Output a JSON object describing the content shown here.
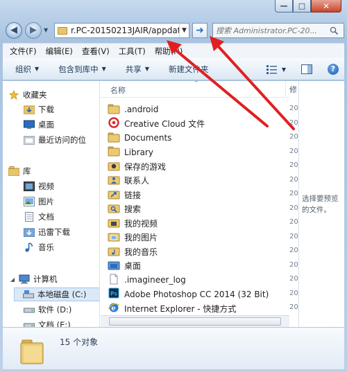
{
  "window": {
    "minimize_glyph": "—",
    "maximize_glyph": "□",
    "close_glyph": "✕"
  },
  "address": {
    "path": "r.PC-20150213JAIR/appdata",
    "go_glyph": "➜"
  },
  "search": {
    "placeholder": "搜索 Administrator.PC-20..."
  },
  "menu": [
    "文件(F)",
    "编辑(E)",
    "查看(V)",
    "工具(T)",
    "帮助(H)"
  ],
  "toolbar": {
    "organize": "组织",
    "include_in_library": "包含到库中",
    "share": "共享",
    "new_folder": "新建文件夹",
    "help_glyph": "?"
  },
  "nav_pane": {
    "favorites_header": "收藏夹",
    "favorites": [
      "下载",
      "桌面",
      "最近访问的位"
    ],
    "libraries_header": "库",
    "libraries": [
      "视频",
      "图片",
      "文档",
      "迅雷下载",
      "音乐"
    ],
    "computer_header": "计算机",
    "drives": [
      "本地磁盘 (C:)",
      "软件 (D:)",
      "文档 (E:)"
    ]
  },
  "file_list": {
    "column_name": "名称",
    "column_modified": "修",
    "files": [
      {
        "name": ".android",
        "icon": "folder-icon",
        "date_frag": "20"
      },
      {
        "name": "Creative Cloud 文件",
        "icon": "creative-cloud-icon",
        "date_frag": "20"
      },
      {
        "name": "Documents",
        "icon": "folder-icon",
        "date_frag": "20"
      },
      {
        "name": "Library",
        "icon": "folder-icon",
        "date_frag": "20"
      },
      {
        "name": "保存的游戏",
        "icon": "saved-games-icon",
        "date_frag": "20"
      },
      {
        "name": "联系人",
        "icon": "contacts-icon",
        "date_frag": "20"
      },
      {
        "name": "链接",
        "icon": "links-icon",
        "date_frag": "20"
      },
      {
        "name": "搜索",
        "icon": "searches-icon",
        "date_frag": "20"
      },
      {
        "name": "我的视频",
        "icon": "my-videos-icon",
        "date_frag": "20"
      },
      {
        "name": "我的图片",
        "icon": "my-pictures-icon",
        "date_frag": "20"
      },
      {
        "name": "我的音乐",
        "icon": "my-music-icon",
        "date_frag": "20"
      },
      {
        "name": "桌面",
        "icon": "desktop-folder-icon",
        "date_frag": "20"
      },
      {
        "name": ".imagineer_log",
        "icon": "file-icon",
        "date_frag": "20"
      },
      {
        "name": "Adobe Photoshop CC 2014 (32 Bit)",
        "icon": "photoshop-icon",
        "date_frag": "20"
      },
      {
        "name": "Internet Explorer - 快捷方式",
        "icon": "ie-shortcut-icon",
        "date_frag": "20"
      }
    ]
  },
  "preview": {
    "text": "选择要预览的文件。"
  },
  "details": {
    "count": "15 个对象"
  },
  "colors": {
    "annotation_red": "#e02020",
    "folder_yellow": "#e8c56d",
    "selection_blue": "#dae8f8"
  }
}
